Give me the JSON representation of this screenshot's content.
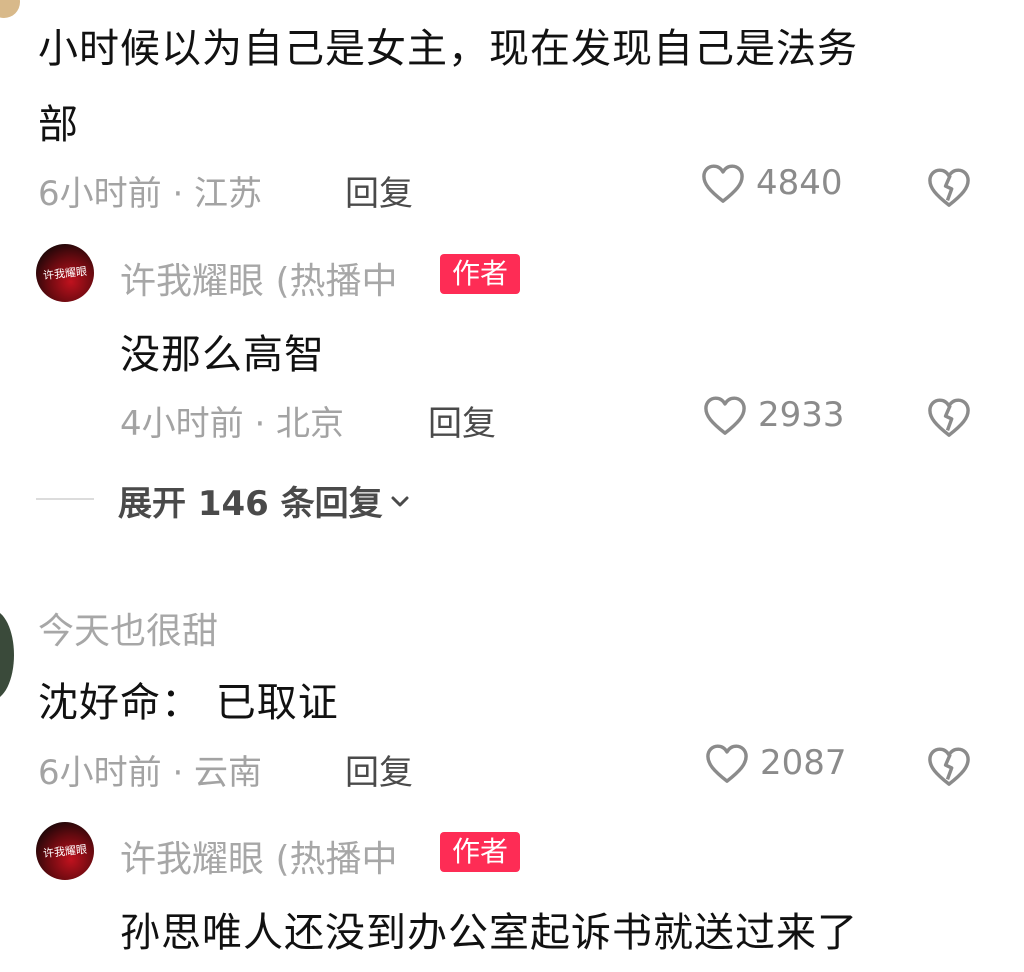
{
  "comments": [
    {
      "text_line1": "小时候以为自己是女主，现在发现自己是法务",
      "text_line2": "部",
      "meta": "6小时前 · 江苏",
      "reply": "回复",
      "likes": "4840",
      "author_reply": {
        "avatar_text": "许我耀眼",
        "username": "许我耀眼 (热播中",
        "badge": "作者",
        "text": "没那么高智",
        "meta": "4小时前 · 北京",
        "reply": "回复",
        "likes": "2933"
      },
      "expand": "展开 146 条回复"
    },
    {
      "username": "今天也很甜",
      "text": "沈好命： 已取证",
      "meta": "6小时前 · 云南",
      "reply": "回复",
      "likes": "2087",
      "author_reply": {
        "avatar_text": "许我耀眼",
        "username": "许我耀眼 (热播中",
        "badge": "作者",
        "text": "孙思唯人还没到办公室起诉书就送过来了"
      }
    }
  ],
  "colors": {
    "badge": "#fe2c55",
    "meta": "#a3a3a3",
    "text": "#111111"
  },
  "icons": [
    "heart-outline-icon",
    "broken-heart-icon",
    "chevron-down-icon"
  ]
}
